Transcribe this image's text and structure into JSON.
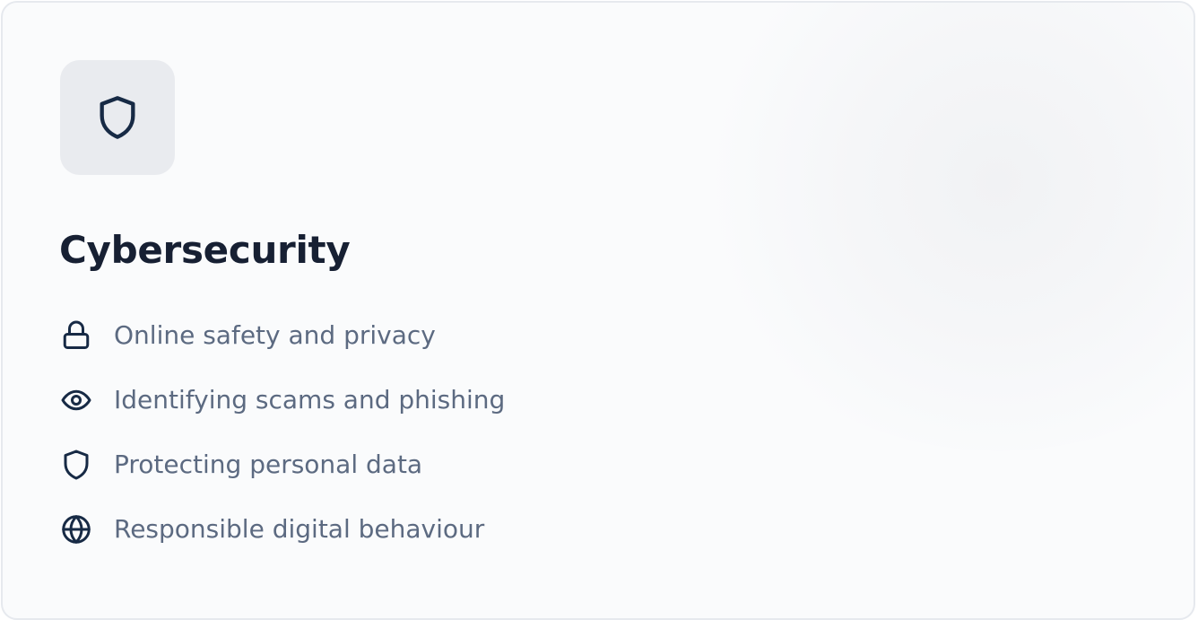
{
  "card": {
    "title": "Cybersecurity",
    "badge_icon": "shield-icon",
    "features": [
      {
        "icon": "lock-icon",
        "label": "Online safety and privacy"
      },
      {
        "icon": "eye-icon",
        "label": "Identifying scams and phishing"
      },
      {
        "icon": "shield-icon",
        "label": "Protecting personal data"
      },
      {
        "icon": "globe-icon",
        "label": "Responsible digital behaviour"
      }
    ]
  },
  "colors": {
    "title": "#172033",
    "text_muted": "#5c6a81",
    "icon_stroke": "#172a45",
    "badge_bg": "#e9ebef",
    "card_bg": "#fafbfc",
    "card_border": "#e6e9ee"
  }
}
